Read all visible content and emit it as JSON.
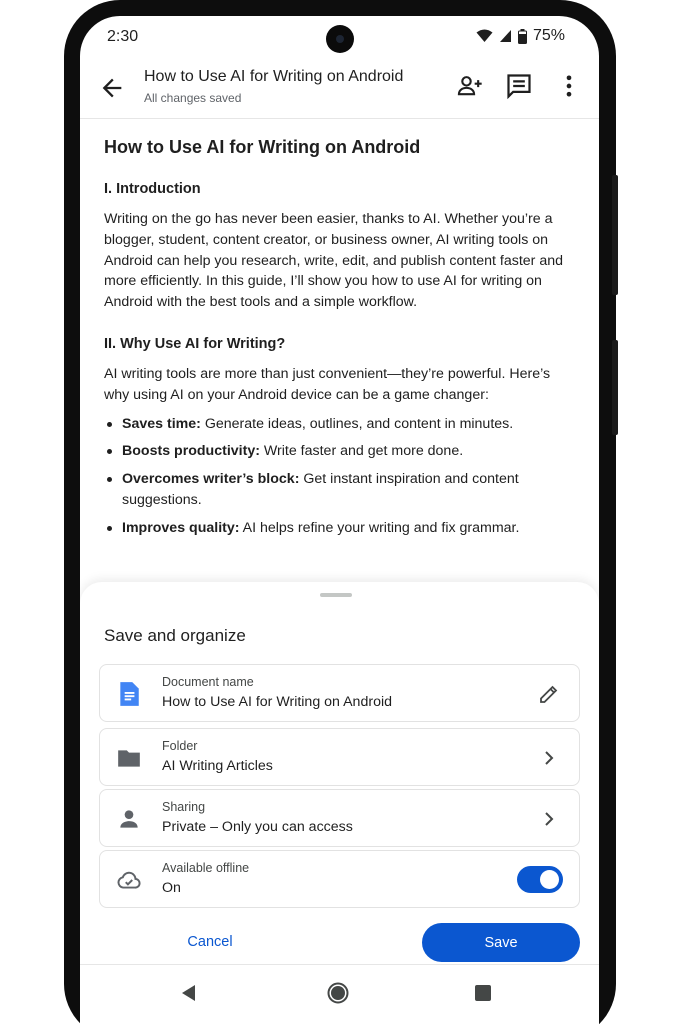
{
  "status_bar": {
    "time": "2:30",
    "battery": "75%"
  },
  "app_bar": {
    "title": "How to Use AI for Writing on Android",
    "subtitle": "All changes saved"
  },
  "document": {
    "title": "How to Use AI for Writing on Android",
    "section1_heading": "I. Introduction",
    "section1_body": "Writing on the go has never been easier, thanks to AI. Whether you’re a blogger, student, content creator, or business owner, AI writing tools on Android can help you research, write, edit, and publish content faster and more efficiently. In this guide, I’ll show you how to use AI for writing on Android with the best tools and a simple workflow.",
    "section2_heading": "II. Why Use AI for Writing?",
    "section2_body": "AI writing tools are more than just convenient—they’re powerful. Here’s why using AI on your Android device can be a game changer:",
    "bullets": [
      {
        "bold": "Saves time:",
        "text": " Generate ideas, outlines, and content in minutes."
      },
      {
        "bold": "Boosts productivity:",
        "text": " Write faster and get more done."
      },
      {
        "bold": "Overcomes writer’s block:",
        "text": " Get instant inspiration and content suggestions."
      },
      {
        "bold": "Improves quality:",
        "text": " AI helps refine your writing and fix grammar."
      }
    ]
  },
  "sheet": {
    "title": "Save and organize",
    "doc_name": {
      "label": "Document name",
      "value": "How to Use AI for Writing on Android"
    },
    "folder": {
      "label": "Folder",
      "value": "AI Writing Articles"
    },
    "sharing": {
      "label": "Sharing",
      "value": "Private – Only you can access"
    },
    "offline": {
      "label": "Available offline",
      "value": "On",
      "enabled": true
    },
    "cancel_label": "Cancel",
    "save_label": "Save"
  },
  "colors": {
    "accent": "#0b57d0",
    "docs_blue": "#4285f4",
    "icon_gray": "#5f6368"
  },
  "icons": [
    "back-arrow-icon",
    "add-person-icon",
    "comment-icon",
    "more-vert-icon",
    "docs-icon",
    "edit-pencil-icon",
    "folder-icon",
    "person-icon",
    "chevron-right-icon",
    "cloud-check-icon",
    "nav-back-icon",
    "nav-home-icon",
    "nav-recents-icon",
    "wifi-icon",
    "signal-icon",
    "battery-icon"
  ]
}
